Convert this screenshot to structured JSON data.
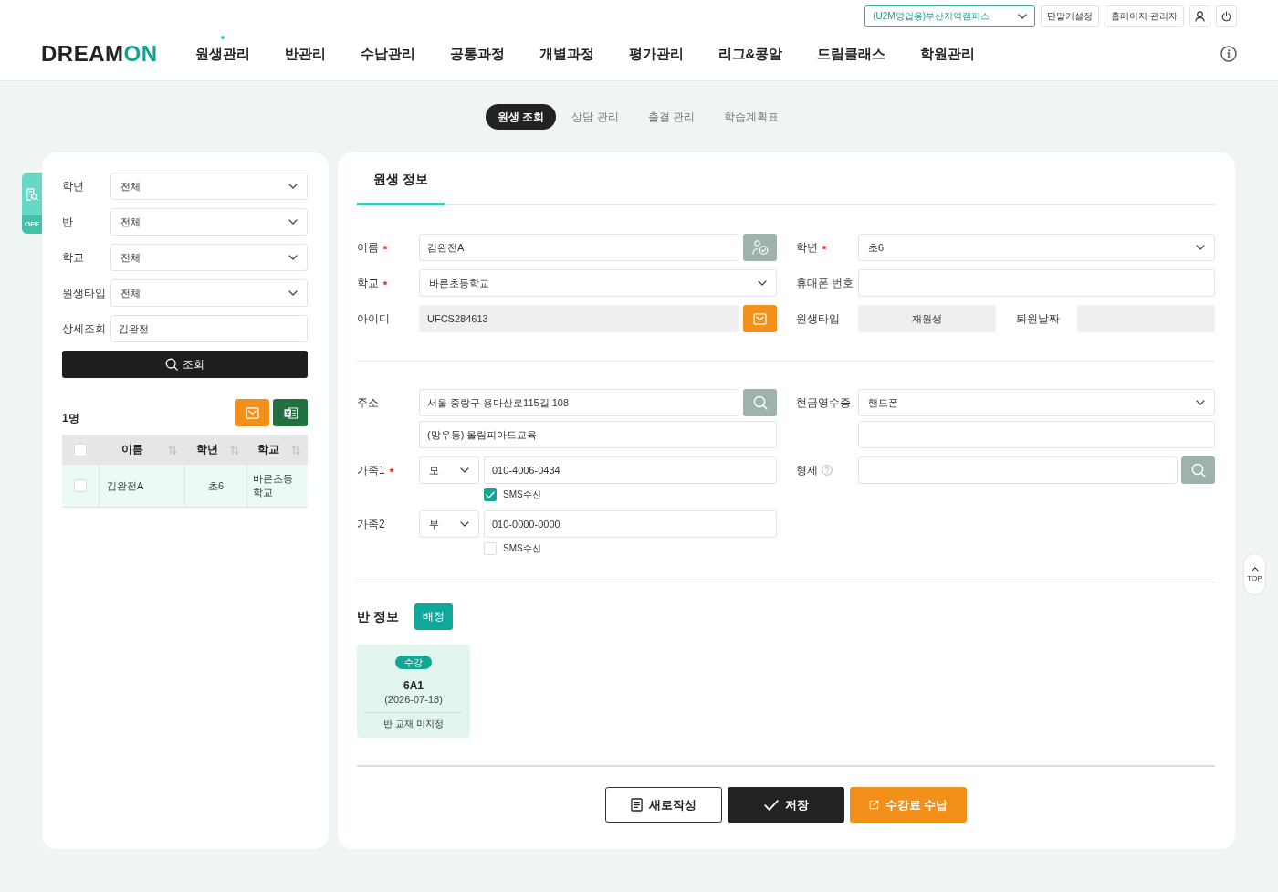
{
  "header": {
    "campus_select": "(U2M영업용)부산지역캠퍼스",
    "utility_buttons": [
      "단말기설정",
      "홈페이지 관리자"
    ],
    "logo": [
      {
        "text": "DREAM",
        "color": "#222222"
      },
      {
        "text": "ON",
        "color": "#16a093"
      }
    ],
    "nav": [
      {
        "label": "원생관리",
        "selected": true
      },
      {
        "label": "반관리",
        "selected": false
      },
      {
        "label": "수납관리",
        "selected": false
      },
      {
        "label": "공통과정",
        "selected": false
      },
      {
        "label": "개별과정",
        "selected": false
      },
      {
        "label": "평가관리",
        "selected": false
      },
      {
        "label": "리그&콩알",
        "selected": false
      },
      {
        "label": "드림클래스",
        "selected": false
      },
      {
        "label": "학원관리",
        "selected": false
      }
    ]
  },
  "sub_tabs": [
    {
      "label": "원생 조회",
      "selected": true
    },
    {
      "label": "상담 관리",
      "selected": false
    },
    {
      "label": "출결 관리",
      "selected": false
    },
    {
      "label": "학습계획표",
      "selected": false
    }
  ],
  "side_toggle": "OFF",
  "filter_panel": {
    "filters": [
      {
        "label": "학년",
        "kind": "select",
        "value": "전체"
      },
      {
        "label": "반",
        "kind": "select",
        "value": "전체"
      },
      {
        "label": "학교",
        "kind": "select",
        "value": "전체"
      },
      {
        "label": "원생타입",
        "kind": "select",
        "value": "전체"
      },
      {
        "label": "상세조회",
        "kind": "input",
        "value": "김완전"
      }
    ],
    "search_button": "조회",
    "result_count": "1명",
    "table": {
      "select_all": {
        "checked": false
      },
      "columns": [
        "이름",
        "학년",
        "학교"
      ],
      "rows": [
        {
          "selected": true,
          "checked": false,
          "cells": [
            "김완전A",
            "초6",
            "바른초등학교"
          ]
        }
      ]
    }
  },
  "student_info": {
    "title": "원생 정보",
    "basic": {
      "left": [
        {
          "label": "이름",
          "required": true,
          "kind": "input",
          "value": "김완전A",
          "action": {
            "kind": "verify"
          }
        },
        {
          "label": "학교",
          "required": true,
          "kind": "select",
          "value": "바른초등학교"
        },
        {
          "label": "아이디",
          "required": false,
          "kind": "readonly",
          "value": "UFCS284613",
          "action": {
            "kind": "mail"
          }
        }
      ],
      "right": [
        {
          "label": "학년",
          "required": true,
          "kind": "select",
          "value": "초6"
        },
        {
          "label": "휴대폰 번호",
          "required": false,
          "kind": "input"
        },
        {
          "label": "원생타입",
          "required": false,
          "kind": "split",
          "value": "재원생",
          "second_label": "퇴원날짜"
        }
      ]
    },
    "contact": {
      "left": [
        {
          "label": "주소",
          "required": false,
          "kind": "address",
          "lines": [
            "서울 중랑구 용마산로115길 108",
            "(망우동) 올림피아드교육"
          ],
          "action": {
            "kind": "search"
          }
        },
        {
          "label": "가족1",
          "required": true,
          "kind": "family",
          "relation": "모",
          "phone": "010-4006-0434",
          "sms": {
            "label": "SMS수신",
            "checked": true
          }
        },
        {
          "label": "가족2",
          "required": false,
          "kind": "family",
          "relation": "부",
          "phone": "010-0000-0000",
          "sms": {
            "label": "SMS수신",
            "checked": false
          }
        }
      ],
      "right": [
        {
          "label": "현금영수증",
          "required": false,
          "kind": "select-extra",
          "value": "핸드폰"
        },
        {
          "label": "형제",
          "required": false,
          "help": true,
          "kind": "input",
          "action": {
            "kind": "search"
          }
        }
      ]
    }
  },
  "class_info": {
    "title": "반 정보",
    "assign_button": "배정",
    "classes": [
      {
        "status": "수강",
        "name": "6A1",
        "date": "(2026-07-18)",
        "textbook": "반 교재 미지정"
      }
    ]
  },
  "footer_buttons": [
    {
      "label": "새로작성",
      "kind": "new"
    },
    {
      "label": "저장",
      "kind": "save"
    },
    {
      "label": "수강료 수납",
      "kind": "payment"
    }
  ],
  "scroll_top": "TOP"
}
